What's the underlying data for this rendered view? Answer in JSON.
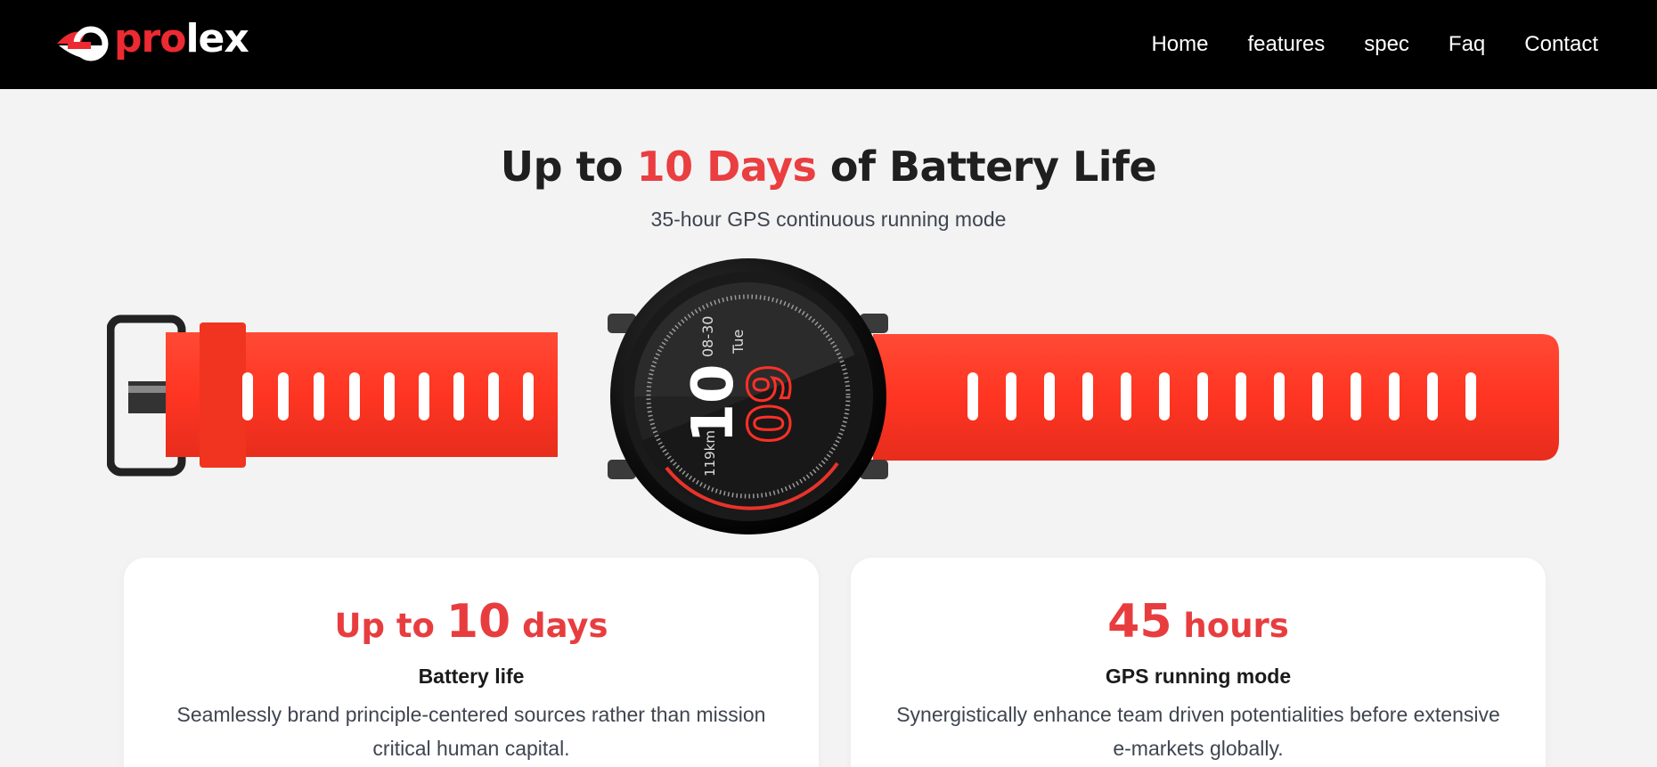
{
  "brand": {
    "name_pro": "pro",
    "name_lex": "lex",
    "accent": "#ed2a31"
  },
  "nav": {
    "items": [
      {
        "label": "Home"
      },
      {
        "label": "features"
      },
      {
        "label": "spec"
      },
      {
        "label": "Faq"
      },
      {
        "label": "Contact"
      }
    ]
  },
  "hero": {
    "title_before": "Up to ",
    "title_accent": "10 Days",
    "title_after": " of Battery Life",
    "subtitle": "35-hour GPS continuous running mode"
  },
  "watch": {
    "hour": "10",
    "minute": "09",
    "date": "08-30",
    "day": "Tue",
    "distance": "119km"
  },
  "cards": [
    {
      "stat_prefix": "Up to ",
      "stat_number": "10",
      "stat_suffix": " days",
      "label": "Battery life",
      "text": "Seamlessly brand principle-centered sources rather than mission critical human capital."
    },
    {
      "stat_prefix": "",
      "stat_number": "45",
      "stat_suffix": " hours",
      "label": "GPS running mode",
      "text": "Synergistically enhance team driven potentialities before extensive e-markets globally."
    }
  ],
  "colors": {
    "strap": "#ff3a28",
    "accent_text": "#ea3e40",
    "navbar": "#000000",
    "page_bg": "#f3f3f3"
  }
}
